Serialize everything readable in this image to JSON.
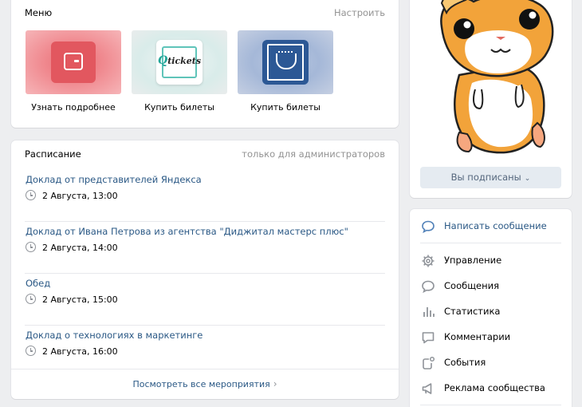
{
  "menu": {
    "title": "Меню",
    "action": "Настроить",
    "items": [
      {
        "label": "Узнать подробнее",
        "icon": "wallet-icon",
        "color": "#e2575f"
      },
      {
        "label": "Купить билеты",
        "icon": "qtickets-logo",
        "logo_text": "tickets",
        "logo_letter": "Q"
      },
      {
        "label": "Купить билеты",
        "icon": "ticket-cup-icon",
        "color": "#2c5895"
      }
    ]
  },
  "schedule": {
    "title": "Расписание",
    "note": "только для администраторов",
    "events": [
      {
        "title": "Доклад от представителей Яндекса",
        "time": "2 Августа, 13:00"
      },
      {
        "title": "Доклад от Ивана Петрова из агентства \"Диджитал мастерс плюс\"",
        "time": "2 Августа, 14:00"
      },
      {
        "title": "Обед",
        "time": "2 Августа, 15:00"
      },
      {
        "title": "Доклад о технологиях в маркетинге",
        "time": "2 Августа, 16:00"
      }
    ],
    "all_link": "Посмотреть все мероприятия"
  },
  "profile": {
    "subscribe_label": "Вы подписаны"
  },
  "actions": {
    "primary": {
      "label": "Написать сообщение",
      "icon": "message-bubble-icon"
    },
    "items": [
      {
        "label": "Управление",
        "icon": "gear-icon"
      },
      {
        "label": "Сообщения",
        "icon": "message-bubble-icon"
      },
      {
        "label": "Статистика",
        "icon": "bar-chart-icon"
      },
      {
        "label": "Комментарии",
        "icon": "comment-icon"
      },
      {
        "label": "События",
        "icon": "events-icon"
      },
      {
        "label": "Реклама сообщества",
        "icon": "megaphone-icon"
      }
    ]
  },
  "colors": {
    "accent": "#2a5885",
    "icon_blue": "#5181b8",
    "background": "#edeef0"
  }
}
